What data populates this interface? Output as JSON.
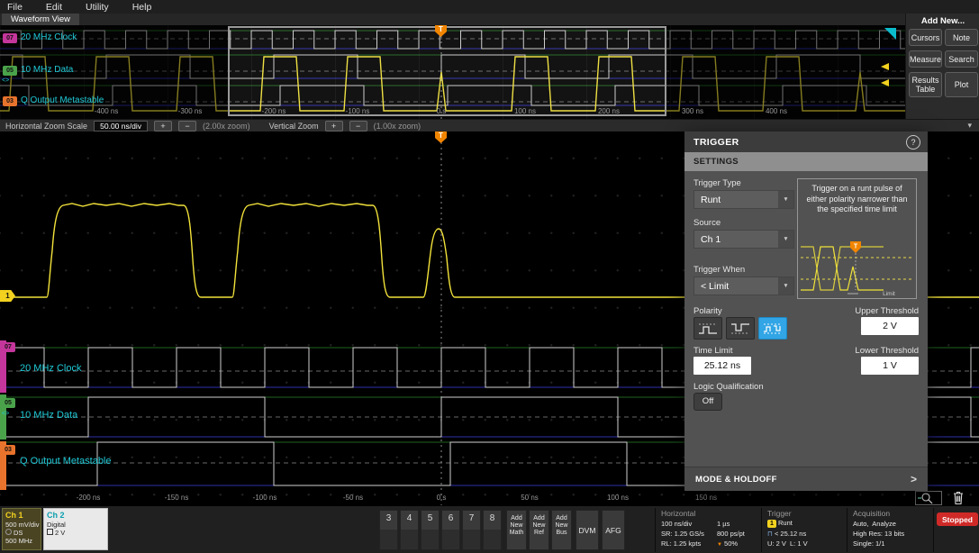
{
  "menu": {
    "items": [
      "File",
      "Edit",
      "Utility",
      "Help"
    ]
  },
  "view_tab": "Waveform View",
  "add_new": {
    "title": "Add New...",
    "cursors": "Cursors",
    "note": "Note",
    "measure": "Measure",
    "search": "Search",
    "results_table": "Results Table",
    "plot": "Plot"
  },
  "overview": {
    "badges": {
      "d7": "07",
      "d5": "05",
      "d3": "03"
    },
    "labels": {
      "clock": "20 MHz Clock",
      "data": "10 MHz Data",
      "meta": "Q Output Metastable"
    },
    "axis": [
      "-400 ns",
      "-300 ns",
      "-200 ns",
      "-100 ns",
      "0 s",
      "100 ns",
      "200 ns",
      "300 ns",
      "400 ns"
    ],
    "trigger_marker": "T",
    "expander": "<>"
  },
  "zoom_bar": {
    "h_label": "Horizontal Zoom Scale",
    "h_scale": "50.00 ns/div",
    "plus": "+",
    "minus": "−",
    "h_zoom": "(2.00x zoom)",
    "v_label": "Vertical Zoom",
    "v_zoom": "(1.00x zoom)",
    "collapse": "▾"
  },
  "main_view": {
    "badges": {
      "d7": "07",
      "d5": "05",
      "d3": "03"
    },
    "labels": {
      "clock": "20 MHz Clock",
      "data": "10 MHz Data",
      "meta": "Q Output Metastable"
    },
    "axis": [
      "-200 ns",
      "-150 ns",
      "-100 ns",
      "-50 ns",
      "0 s",
      "50 ns",
      "100 ns",
      "150 ns"
    ],
    "ch1_marker": "1",
    "trigger_marker": "T",
    "expander": "<>"
  },
  "trigger_panel": {
    "title": "TRIGGER",
    "help": "?",
    "tab": "SETTINGS",
    "trigger_type_label": "Trigger Type",
    "trigger_type_value": "Runt",
    "source_label": "Source",
    "source_value": "Ch 1",
    "trigger_when_label": "Trigger When",
    "trigger_when_value": "< Limit",
    "description": "Trigger on a runt pulse of either polarity narrower than the specified time limit",
    "diagram_t": "T",
    "diagram_limit": "Limit",
    "polarity_label": "Polarity",
    "upper_label": "Upper Threshold",
    "upper_value": "2 V",
    "time_limit_label": "Time Limit",
    "time_limit_value": "25.12 ns",
    "lower_label": "Lower Threshold",
    "lower_value": "1 V",
    "logic_label": "Logic Qualification",
    "logic_value": "Off",
    "mode_holdoff": "MODE & HOLDOFF",
    "mode_chevron": ">",
    "dropdown_arrow": "▼"
  },
  "bottom": {
    "ch1": {
      "name": "Ch 1",
      "scale": "500 mV/div",
      "coupling": "DS",
      "bandwidth": "500 MHz"
    },
    "ch2": {
      "name": "Ch 2",
      "mode": "Digital",
      "threshold": "2 V"
    },
    "channels": [
      "3",
      "4",
      "5",
      "6",
      "7",
      "8"
    ],
    "add_math": "Add New Math",
    "add_ref": "Add New Ref",
    "add_bus": "Add New Bus",
    "dvm": "DVM",
    "afg": "AFG",
    "horizontal": {
      "title": "Horizontal",
      "scale": "100 ns/div",
      "window": "1 µs",
      "sample_rate": "SR: 1.25 GS/s",
      "resolution": "800 ps/pt",
      "record_length": "RL: 1.25 kpts",
      "position": "50%"
    },
    "trigger": {
      "title": "Trigger",
      "badge": "1",
      "type": "Runt",
      "limit": "< 25.12 ns",
      "levels": "U: 2 V  L: 1 V"
    },
    "acquisition": {
      "title": "Acquisition",
      "mode": "Auto,  Analyze",
      "detail": "High Res: 13 bits",
      "single": "Single: 1/1"
    },
    "stopped": "Stopped"
  }
}
